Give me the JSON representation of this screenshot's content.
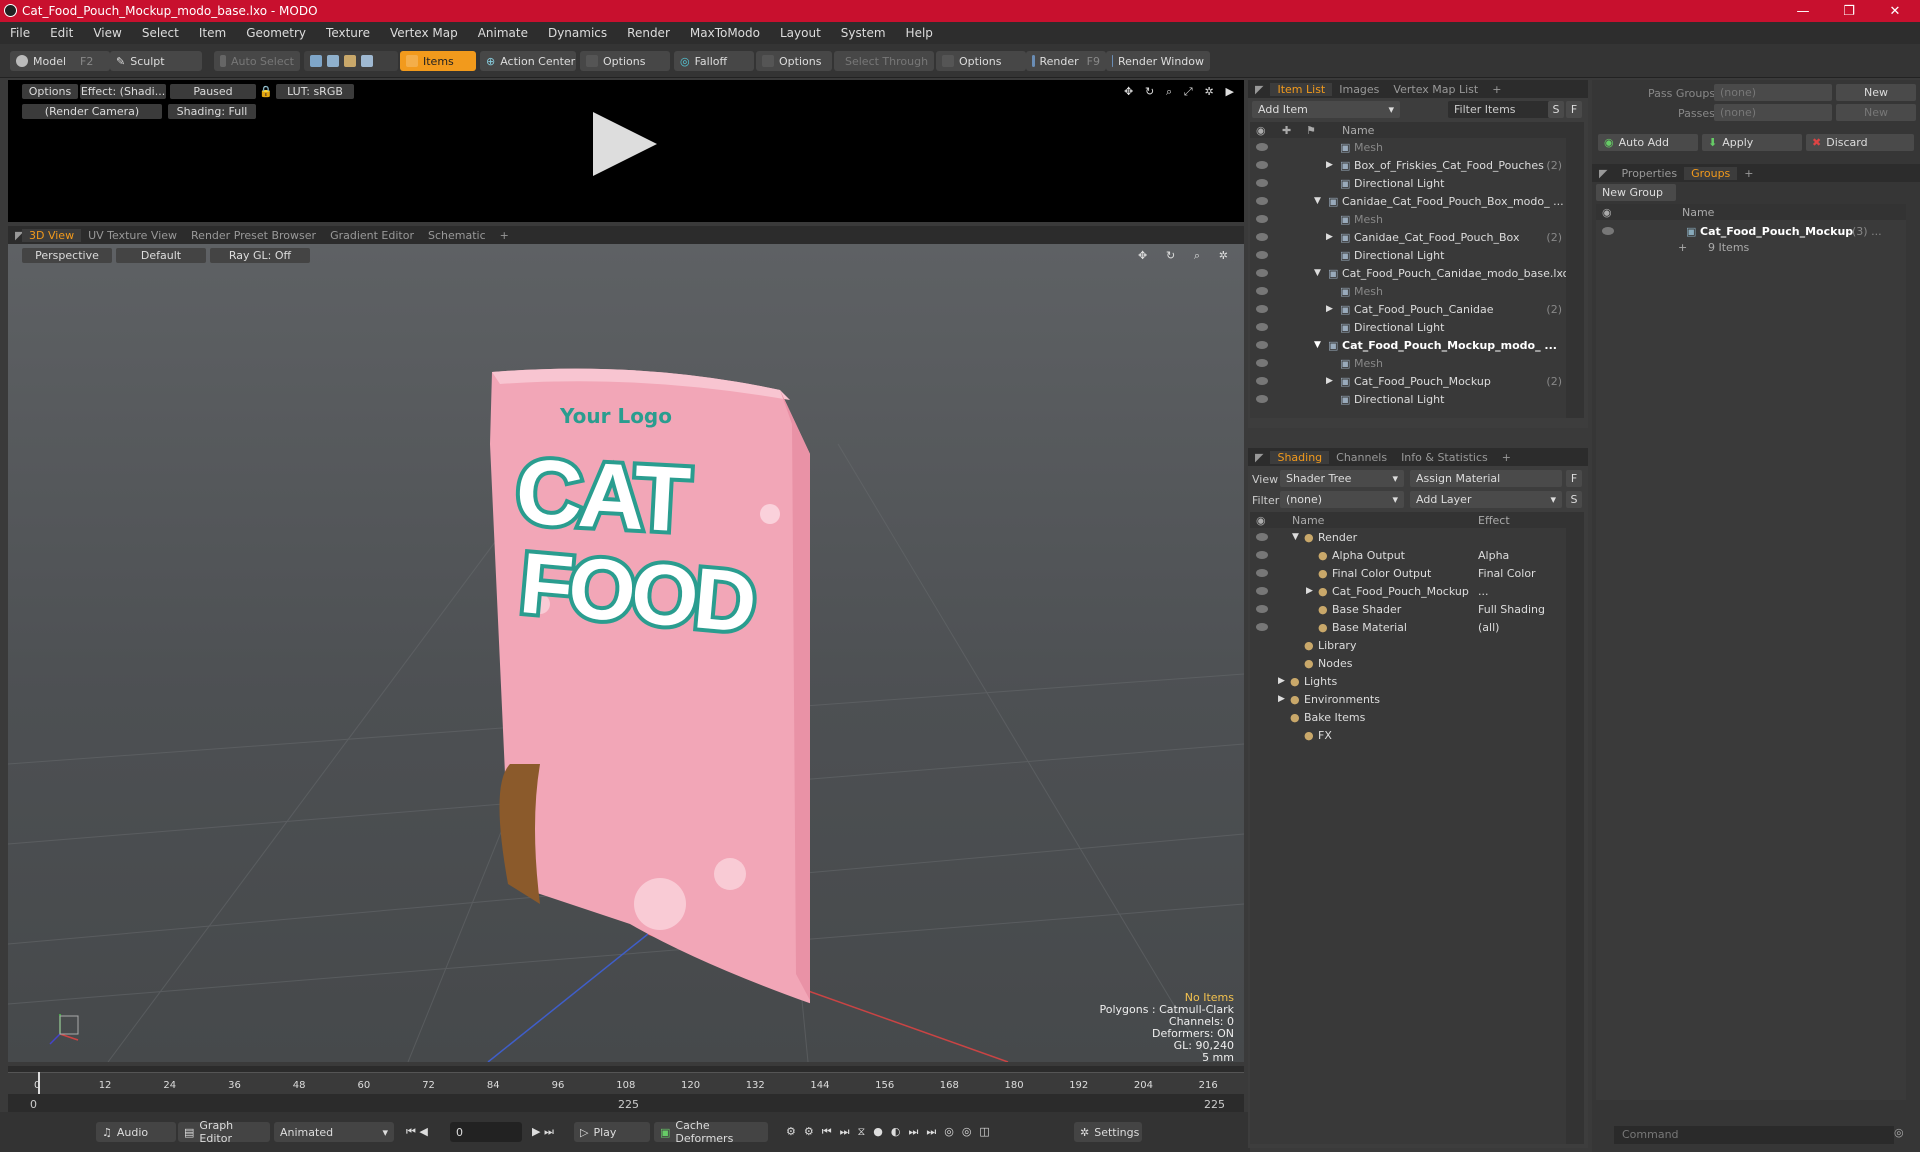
{
  "window": {
    "title": "Cat_Food_Pouch_Mockup_modo_base.lxo - MODO"
  },
  "menu": [
    "File",
    "Edit",
    "View",
    "Select",
    "Item",
    "Geometry",
    "Texture",
    "Vertex Map",
    "Animate",
    "Dynamics",
    "Render",
    "MaxToModo",
    "Layout",
    "System",
    "Help"
  ],
  "toolbar": {
    "model": "Model",
    "model_key": "F2",
    "sculpt": "Sculpt",
    "auto_select": "Auto Select",
    "items": "Items",
    "action_center": "Action Center",
    "options1": "Options",
    "falloff": "Falloff",
    "options2": "Options",
    "select_through": "Select Through",
    "options3": "Options",
    "render": "Render",
    "render_key": "F9",
    "render_window": "Render Window"
  },
  "preview": {
    "options": "Options",
    "effect": "Effect: (Shadi...",
    "paused": "Paused",
    "lut": "LUT: sRGB",
    "camera": "(Render Camera)",
    "shading": "Shading: Full"
  },
  "view_tabs": [
    "3D View",
    "UV Texture View",
    "Render Preset Browser",
    "Gradient Editor",
    "Schematic",
    "+"
  ],
  "viewport": {
    "perspective": "Perspective",
    "default": "Default",
    "raygl": "Ray GL: Off",
    "info": [
      "No Items",
      "Polygons : Catmull-Clark",
      "Channels: 0",
      "Deformers: ON",
      "GL: 90,240",
      "5 mm"
    ]
  },
  "pouch": {
    "logo": "Your Logo",
    "cat": "CAT",
    "food": "FOOD"
  },
  "timeline": {
    "ticks": [
      "0",
      "12",
      "24",
      "36",
      "48",
      "60",
      "72",
      "84",
      "96",
      "108",
      "120",
      "132",
      "144",
      "156",
      "168",
      "180",
      "192",
      "204",
      "216"
    ],
    "start": "0",
    "mid": "225",
    "end": "225"
  },
  "transport": {
    "audio": "Audio",
    "graph_editor": "Graph Editor",
    "animated": "Animated",
    "frame": "0",
    "play": "Play",
    "cache": "Cache Deformers",
    "settings": "Settings"
  },
  "item_list": {
    "tabs": [
      "Item List",
      "Images",
      "Vertex Map List",
      "+"
    ],
    "add_item": "Add Item",
    "filter": "Filter Items",
    "s": "S",
    "f": "F",
    "col_name": "Name",
    "items": [
      {
        "label": "Mesh",
        "dim": true,
        "indent": 3
      },
      {
        "label": "Box_of_Friskies_Cat_Food_Pouches",
        "count": "(2)",
        "indent": 3,
        "arrow": "▶"
      },
      {
        "label": "Directional Light",
        "indent": 3
      },
      {
        "label": "Canidae_Cat_Food_Pouch_Box_modo_ ...",
        "indent": 2,
        "arrow": "▼"
      },
      {
        "label": "Mesh",
        "dim": true,
        "indent": 3
      },
      {
        "label": "Canidae_Cat_Food_Pouch_Box",
        "count": "(2)",
        "indent": 3,
        "arrow": "▶"
      },
      {
        "label": "Directional Light",
        "indent": 3
      },
      {
        "label": "Cat_Food_Pouch_Canidae_modo_base.lxo",
        "indent": 2,
        "arrow": "▼"
      },
      {
        "label": "Mesh",
        "dim": true,
        "indent": 3
      },
      {
        "label": "Cat_Food_Pouch_Canidae",
        "count": "(2)",
        "indent": 3,
        "arrow": "▶"
      },
      {
        "label": "Directional Light",
        "indent": 3
      },
      {
        "label": "Cat_Food_Pouch_Mockup_modo_ ...",
        "indent": 2,
        "arrow": "▼",
        "bold": true
      },
      {
        "label": "Mesh",
        "dim": true,
        "indent": 3
      },
      {
        "label": "Cat_Food_Pouch_Mockup",
        "count": "(2)",
        "indent": 3,
        "arrow": "▶"
      },
      {
        "label": "Directional Light",
        "indent": 3
      }
    ]
  },
  "shading": {
    "tabs": [
      "Shading",
      "Channels",
      "Info & Statistics",
      "+"
    ],
    "view_label": "View",
    "view_value": "Shader Tree",
    "assign": "Assign Material",
    "filter_label": "Filter",
    "filter_value": "(none)",
    "add_layer": "Add Layer",
    "f": "F",
    "s": "S",
    "col_name": "Name",
    "col_effect": "Effect",
    "rows": [
      {
        "label": "Render",
        "effect": "",
        "indent": 1,
        "arrow": "▼"
      },
      {
        "label": "Alpha Output",
        "effect": "Alpha",
        "indent": 2
      },
      {
        "label": "Final Color Output",
        "effect": "Final Color",
        "indent": 2
      },
      {
        "label": "Cat_Food_Pouch_Mockup",
        "effect": "...",
        "indent": 2,
        "arrow": "▶"
      },
      {
        "label": "Base Shader",
        "effect": "Full Shading",
        "indent": 2
      },
      {
        "label": "Base Material",
        "effect": "(all)",
        "indent": 2
      },
      {
        "label": "Library",
        "effect": "",
        "indent": 1
      },
      {
        "label": "Nodes",
        "effect": "",
        "indent": 1
      },
      {
        "label": "Lights",
        "effect": "",
        "indent": 0,
        "arrow": "▶"
      },
      {
        "label": "Environments",
        "effect": "",
        "indent": 0,
        "arrow": "▶"
      },
      {
        "label": "Bake Items",
        "effect": "",
        "indent": 0
      },
      {
        "label": "FX",
        "effect": "",
        "indent": 1
      }
    ]
  },
  "groups": {
    "pass_groups": "Pass Groups",
    "pass_value": "(none)",
    "new": "New",
    "passes": "Passes",
    "passes_value": "(none)",
    "new2": "New",
    "auto_add": "Auto Add",
    "apply": "Apply",
    "discard": "Discard",
    "tabs": [
      "Properties",
      "Groups",
      "+"
    ],
    "new_group": "New Group",
    "col_name": "Name",
    "group_name": "Cat_Food_Pouch_Mockup",
    "group_count": "(3) ...",
    "group_items": "9 Items"
  },
  "command": {
    "placeholder": "Command"
  }
}
